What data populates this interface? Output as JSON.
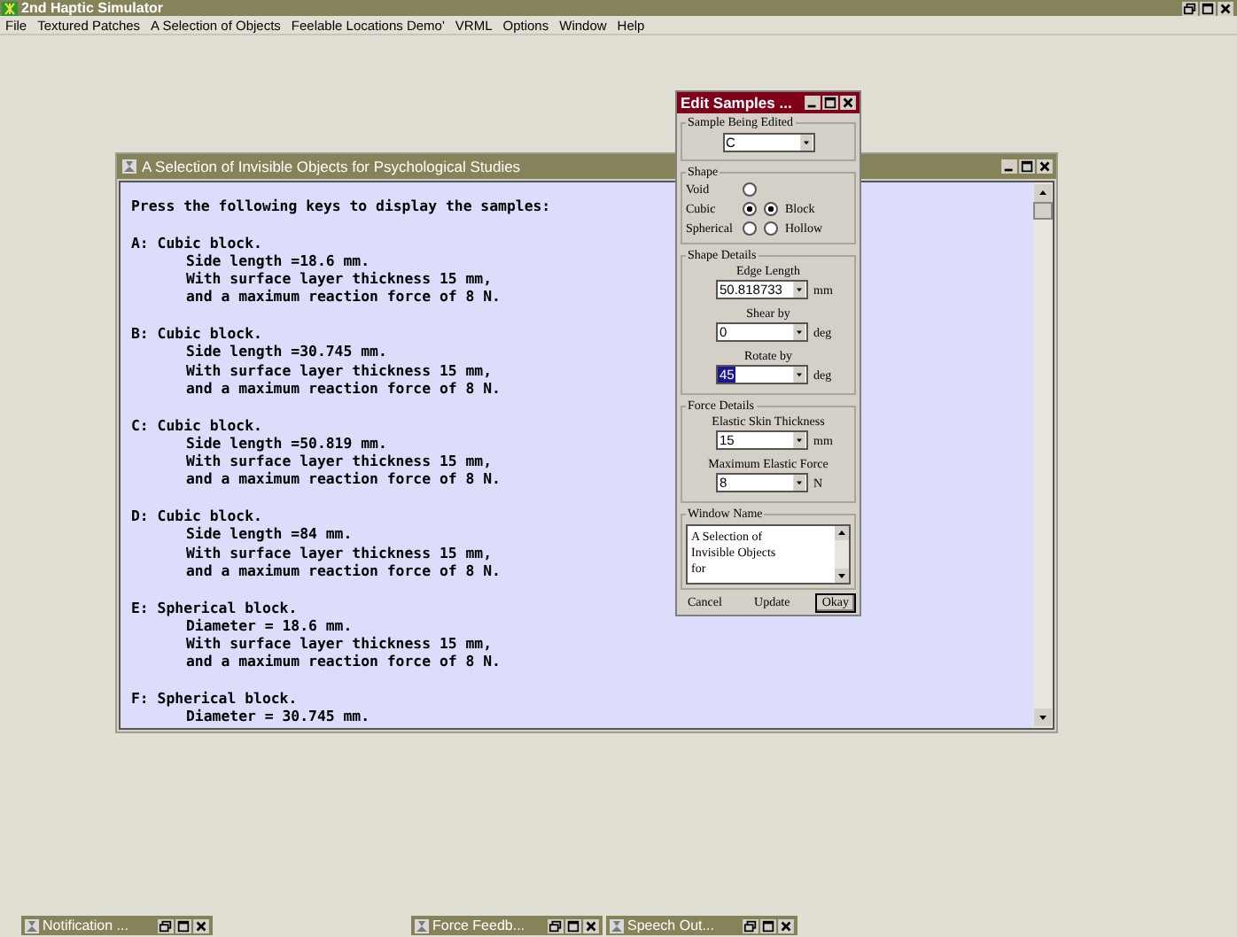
{
  "window": {
    "title": "2nd Haptic Simulator"
  },
  "menu": [
    "File",
    "Textured Patches",
    "A Selection of Objects",
    "Feelable Locations Demo'",
    "VRML",
    "Options",
    "Window",
    "Help"
  ],
  "document": {
    "title": "A Selection of Invisible Objects for Psychological Studies",
    "intro": "Press the following keys to display the samples:",
    "samples": [
      {
        "heading": "A: Cubic block.",
        "details": [
          "Side length =18.6 mm.",
          "With surface layer thickness 15 mm,",
          "and a maximum reaction force of 8 N."
        ]
      },
      {
        "heading": "B: Cubic block.",
        "details": [
          "Side length =30.745 mm.",
          "With surface layer thickness 15 mm,",
          "and a maximum reaction force of 8 N."
        ]
      },
      {
        "heading": "C: Cubic block.",
        "details": [
          "Side length =50.819 mm.",
          "With surface layer thickness 15 mm,",
          "and a maximum reaction force of 8 N."
        ]
      },
      {
        "heading": "D: Cubic block.",
        "details": [
          "Side length =84 mm.",
          "With surface layer thickness 15 mm,",
          "and a maximum reaction force of 8 N."
        ]
      },
      {
        "heading": "E: Spherical block.",
        "details": [
          "Diameter = 18.6 mm.",
          "With surface layer thickness 15 mm,",
          "and a maximum reaction force of 8 N."
        ]
      },
      {
        "heading": "F: Spherical block.",
        "details": [
          "Diameter = 30.745 mm."
        ]
      }
    ]
  },
  "dialog": {
    "title": "Edit Samples ...",
    "sample": {
      "label": "Sample Being Edited",
      "value": "C"
    },
    "shape": {
      "label": "Shape",
      "kinds": [
        {
          "label": "Void",
          "selected": false
        },
        {
          "label": "Cubic",
          "selected": true
        },
        {
          "label": "Spherical",
          "selected": false
        }
      ],
      "styles": [
        {
          "label": "Block",
          "selected": true
        },
        {
          "label": "Hollow",
          "selected": false
        }
      ]
    },
    "shape_details": {
      "label": "Shape Details",
      "fields": [
        {
          "label": "Edge Length",
          "value": "50.818733",
          "unit": "mm",
          "highlighted": false
        },
        {
          "label": "Shear by",
          "value": "0",
          "unit": "deg",
          "highlighted": false
        },
        {
          "label": "Rotate by",
          "value": "45",
          "unit": "deg",
          "highlighted": true
        }
      ]
    },
    "force_details": {
      "label": "Force Details",
      "fields": [
        {
          "label": "Elastic Skin Thickness",
          "value": "15",
          "unit": "mm",
          "highlighted": false
        },
        {
          "label": "Maximum Elastic Force",
          "value": "8",
          "unit": "N",
          "highlighted": false
        }
      ]
    },
    "window_name": {
      "label": "Window Name",
      "value": "A Selection of Invisible Objects for"
    },
    "buttons": [
      {
        "label": "Cancel",
        "default": false
      },
      {
        "label": "Update",
        "default": false
      },
      {
        "label": "Okay",
        "default": true
      }
    ]
  },
  "minimized": [
    {
      "title": "Notification ..."
    },
    {
      "title": "Force Feedb..."
    },
    {
      "title": "Speech Out..."
    }
  ]
}
